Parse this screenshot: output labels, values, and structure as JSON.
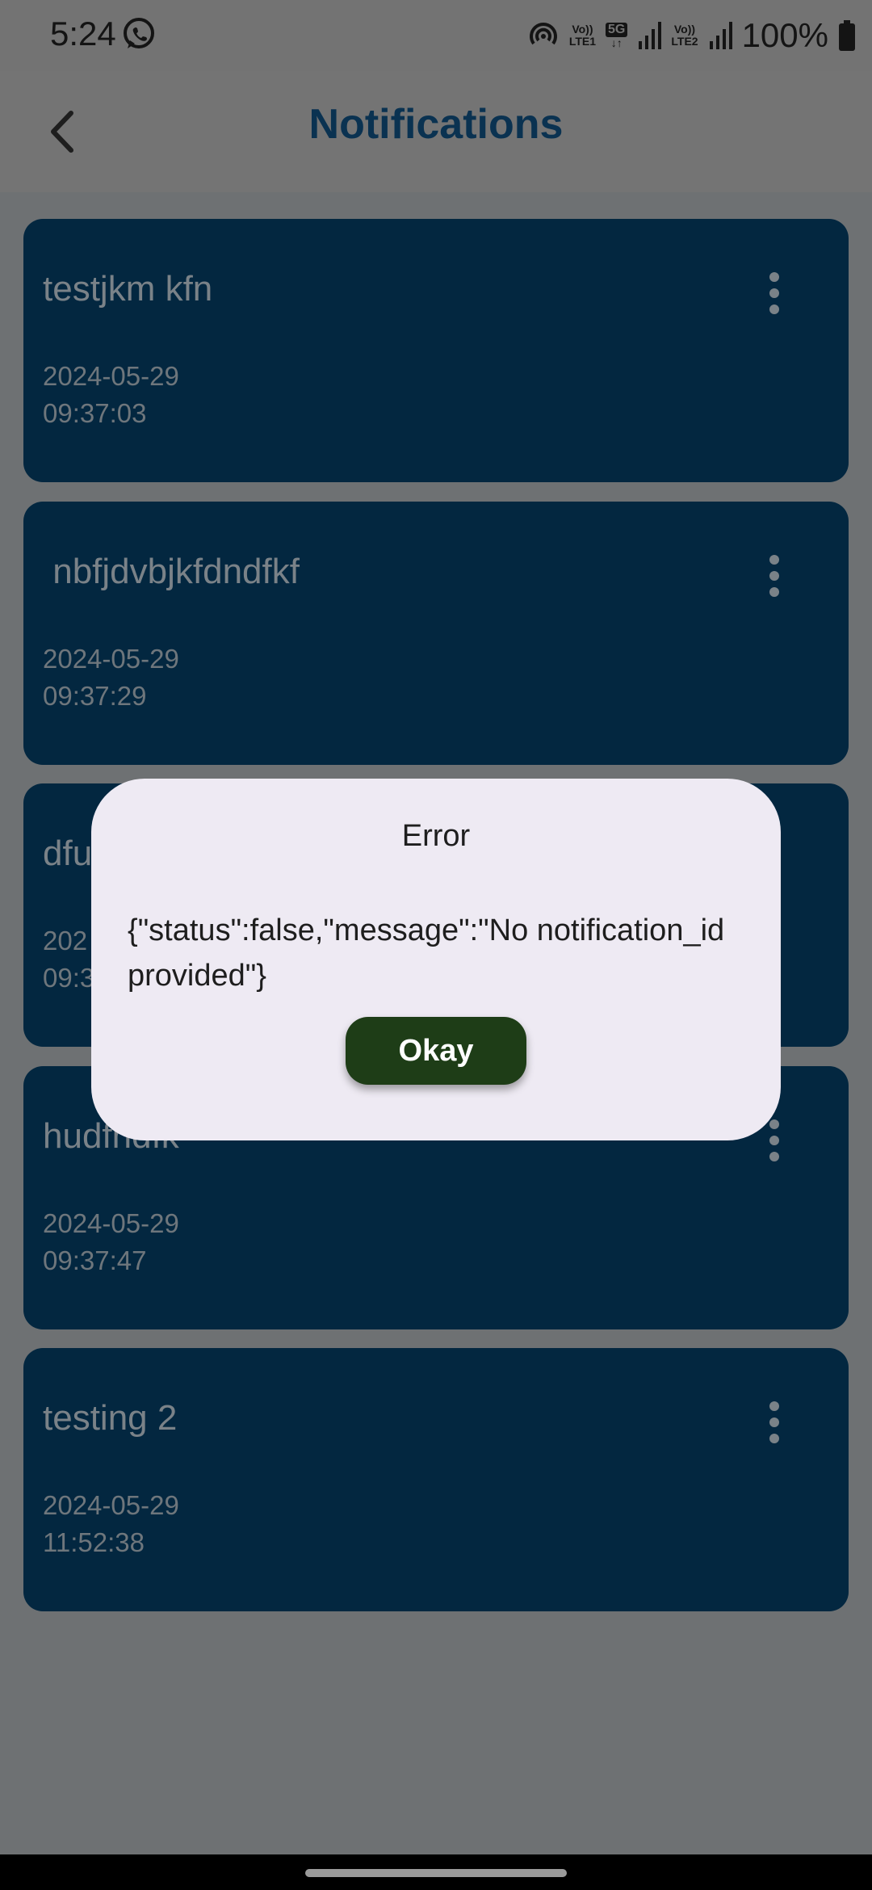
{
  "status_bar": {
    "time": "5:24",
    "battery": "100%",
    "sim1_label_top": "Vo))",
    "sim1_label_bottom": "LTE1",
    "sim2_label_top": "Vo))",
    "sim2_label_bottom": "LTE2",
    "network": "5G",
    "icons": [
      "whatsapp-icon",
      "hotspot-icon",
      "signal-icon",
      "battery-icon"
    ]
  },
  "app_bar": {
    "title": "Notifications",
    "back_icon": "back-arrow-icon"
  },
  "notifications": [
    {
      "title": "testjkm kfn",
      "date": "2024-05-29",
      "time": "09:37:03"
    },
    {
      "title": " nbfjdvbjkfdndfkf",
      "date": "2024-05-29",
      "time": "09:37:29"
    },
    {
      "title": "dfu",
      "date": "202",
      "time": "09:3"
    },
    {
      "title": "hudfndfk",
      "date": "2024-05-29",
      "time": "09:37:47"
    },
    {
      "title": "testing 2",
      "date": "2024-05-29",
      "time": "11:52:38"
    }
  ],
  "dialog": {
    "title": "Error",
    "message": "{\"status\":false,\"message\":\"No notification_id provided\"}",
    "button": "Okay"
  },
  "colors": {
    "card_bg": "#032740",
    "title_color": "#0a3251",
    "dialog_bg": "#eeeaf3",
    "button_bg": "#1e3d17"
  }
}
